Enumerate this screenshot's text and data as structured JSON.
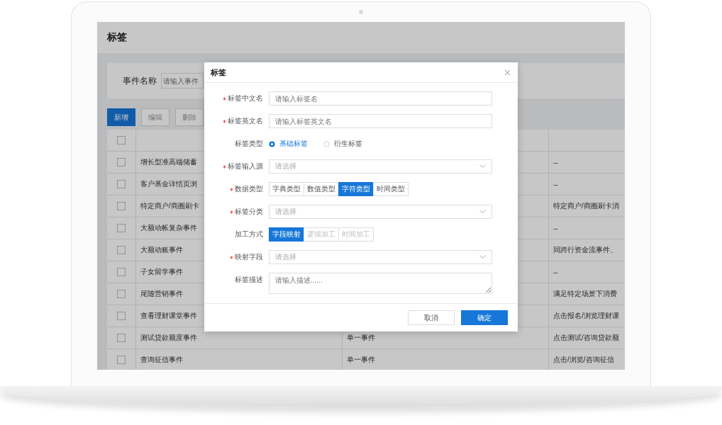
{
  "page": {
    "title": "标签"
  },
  "filter": {
    "label": "事件名称",
    "placeholder": "请输入事件"
  },
  "toolbar": [
    {
      "label": "新增",
      "kind": "primary"
    },
    {
      "label": "编辑",
      "kind": "default"
    },
    {
      "label": "删除",
      "kind": "default"
    }
  ],
  "table": {
    "header_checked": false,
    "rows": [
      {
        "checked": false,
        "name": "增长型准高端储蓄",
        "description": "--"
      },
      {
        "checked": false,
        "name": "客户基金详情页浏",
        "description": "--"
      },
      {
        "checked": false,
        "name": "特定商户/商圈刷卡",
        "description": "特定商户/商圈刷卡消"
      },
      {
        "checked": false,
        "name": "大额动帐复杂事件",
        "description": "--"
      },
      {
        "checked": false,
        "name": "大额动账事件",
        "description": "同跨行资金流事件、"
      },
      {
        "checked": false,
        "name": "子女留学事件",
        "description": "--"
      },
      {
        "checked": false,
        "name": "尾随营销事件",
        "description": "满足特定场景下消费"
      },
      {
        "checked": false,
        "name": "查看理财课堂事件",
        "description": "点击报名/浏览理财课"
      },
      {
        "checked": false,
        "name": "测试贷款额度事件",
        "type": "单一事件",
        "description": "点击测试/咨询贷款额"
      },
      {
        "checked": false,
        "name": "查询征信事件",
        "type": "单一事件",
        "description": "点击/浏览/咨询征信"
      }
    ]
  },
  "dialog": {
    "title": "标签",
    "fields": [
      {
        "kind": "input",
        "label": "标签中文名",
        "required": true,
        "placeholder": "请输入标签名"
      },
      {
        "kind": "input",
        "label": "标签英文名",
        "required": true,
        "placeholder": "请输入标签英文名"
      },
      {
        "kind": "radio",
        "label": "标签类型",
        "required": false,
        "options": [
          {
            "label": "基础标签",
            "selected": true
          },
          {
            "label": "衍生标签",
            "selected": false
          }
        ]
      },
      {
        "kind": "select",
        "label": "标签输入源",
        "required": true,
        "placeholder": "请选择"
      },
      {
        "kind": "segmented",
        "label": "数据类型",
        "required": true,
        "options": [
          {
            "label": "字典类型",
            "selected": false,
            "disabled": false
          },
          {
            "label": "数值类型",
            "selected": false,
            "disabled": false
          },
          {
            "label": "字符类型",
            "selected": true,
            "disabled": false
          },
          {
            "label": "时间类型",
            "selected": false,
            "disabled": false
          }
        ]
      },
      {
        "kind": "select",
        "label": "标签分类",
        "required": true,
        "placeholder": "请选择"
      },
      {
        "kind": "segmented",
        "label": "加工方式",
        "required": false,
        "options": [
          {
            "label": "字段映射",
            "selected": true,
            "disabled": false
          },
          {
            "label": "逻辑加工",
            "selected": false,
            "disabled": true
          },
          {
            "label": "时间加工",
            "selected": false,
            "disabled": true
          }
        ]
      },
      {
        "kind": "select",
        "label": "映射字段",
        "required": true,
        "placeholder": "请选择"
      },
      {
        "kind": "textarea",
        "label": "标签描述",
        "required": false,
        "placeholder": "请输入描述......"
      }
    ],
    "buttons": [
      {
        "label": "取消",
        "kind": "default"
      },
      {
        "label": "确定",
        "kind": "primary"
      }
    ]
  }
}
